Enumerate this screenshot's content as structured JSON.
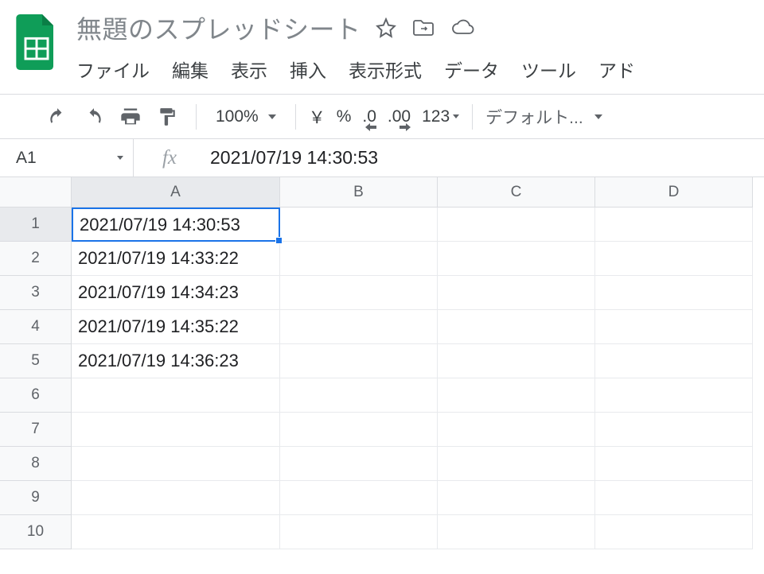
{
  "header": {
    "title": "無題のスプレッドシート"
  },
  "menu": {
    "file": "ファイル",
    "edit": "編集",
    "view": "表示",
    "insert": "挿入",
    "format": "表示形式",
    "data": "データ",
    "tools": "ツール",
    "addons": "アド"
  },
  "toolbar": {
    "zoom": "100%",
    "currency": "￥",
    "percent": "%",
    "dec_decrease": ".0",
    "dec_increase": ".00",
    "more_formats": "123",
    "font": "デフォルト..."
  },
  "namebox": {
    "ref": "A1"
  },
  "formula_bar": {
    "value": "2021/07/19 14:30:53"
  },
  "columns": [
    "A",
    "B",
    "C",
    "D"
  ],
  "rows": [
    "1",
    "2",
    "3",
    "4",
    "5",
    "6",
    "7",
    "8",
    "9",
    "10"
  ],
  "cells": {
    "A1": "2021/07/19 14:30:53",
    "A2": "2021/07/19 14:33:22",
    "A3": "2021/07/19 14:34:23",
    "A4": "2021/07/19 14:35:22",
    "A5": "2021/07/19 14:36:23"
  },
  "selected_cell": "A1"
}
